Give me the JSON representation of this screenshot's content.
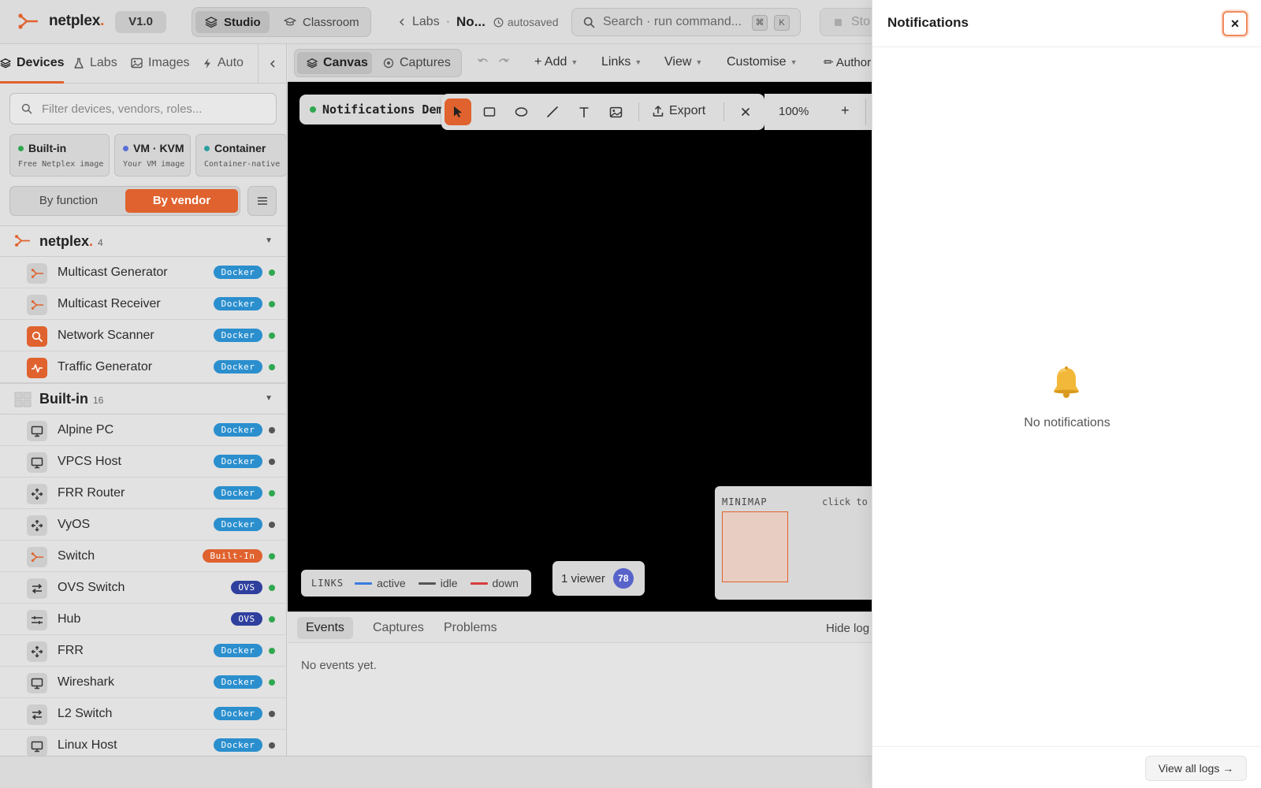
{
  "header": {
    "app_name": "netplex",
    "app_name_suffix": ".",
    "version": "V1.0",
    "modes": [
      "Studio",
      "Classroom"
    ],
    "active_mode": "Studio",
    "breadcrumb": {
      "back_label": "Labs",
      "separator": "·",
      "lab_name": "No..."
    },
    "autosave_status": "autosaved",
    "search": {
      "placeholder": "Search · run command...",
      "shortcut_keys": [
        "⌘",
        "K"
      ]
    },
    "stop_label": "Sto"
  },
  "sidebar": {
    "tabs": [
      "Devices",
      "Labs",
      "Images",
      "Auto"
    ],
    "active_tab": "Devices",
    "filter_placeholder": "Filter devices, vendors, roles...",
    "type_cards": [
      {
        "title": "Built-in",
        "subtitle": "Free Netplex image",
        "color": "#2fa84f"
      },
      {
        "title": "VM · KVM",
        "subtitle": "Your VM image",
        "color": "#5b6fd8"
      },
      {
        "title": "Container",
        "subtitle": "Container-native",
        "color": "#2ba0a0"
      }
    ],
    "grouping": {
      "options": [
        "By function",
        "By vendor"
      ],
      "active": "By vendor"
    },
    "sections": [
      {
        "title": "netplex",
        "title_suffix": ".",
        "count": "4",
        "devices": [
          {
            "name": "Multicast Generator",
            "badge": "Docker",
            "status": "up"
          },
          {
            "name": "Multicast Receiver",
            "badge": "Docker",
            "status": "up"
          },
          {
            "name": "Network Scanner",
            "badge": "Docker",
            "status": "up"
          },
          {
            "name": "Traffic Generator",
            "badge": "Docker",
            "status": "up"
          }
        ]
      },
      {
        "title": "Built-in",
        "title_suffix": "",
        "count": "16",
        "devices": [
          {
            "name": "Alpine PC",
            "badge": "Docker",
            "status": "idle"
          },
          {
            "name": "VPCS Host",
            "badge": "Docker",
            "status": "idle"
          },
          {
            "name": "FRR Router",
            "badge": "Docker",
            "status": "up"
          },
          {
            "name": "VyOS",
            "badge": "Docker",
            "status": "idle"
          },
          {
            "name": "Switch",
            "badge": "Built-In",
            "status": "up"
          },
          {
            "name": "OVS Switch",
            "badge": "OVS",
            "status": "up"
          },
          {
            "name": "Hub",
            "badge": "OVS",
            "status": "up"
          },
          {
            "name": "FRR",
            "badge": "Docker",
            "status": "up"
          },
          {
            "name": "Wireshark",
            "badge": "Docker",
            "status": "up"
          },
          {
            "name": "L2 Switch",
            "badge": "Docker",
            "status": "idle"
          },
          {
            "name": "Linux Host",
            "badge": "Docker",
            "status": "idle"
          }
        ]
      }
    ]
  },
  "workspace": {
    "views": [
      "Canvas",
      "Captures"
    ],
    "active_view": "Canvas",
    "menus": [
      "+ Add",
      "Links",
      "View",
      "Customise"
    ],
    "author_label": "✏ Author",
    "lab_title": "Notifications Demo",
    "export_label": "Export",
    "zoom": "100%",
    "zoom_in": "+",
    "legend": {
      "title": "LINKS",
      "items": [
        {
          "label": "active",
          "color": "#3a7be0"
        },
        {
          "label": "idle",
          "color": "#555555"
        },
        {
          "label": "down",
          "color": "#d83b3b"
        }
      ]
    },
    "viewers": {
      "label": "1 viewer",
      "avatar": "78"
    },
    "minimap": {
      "title": "MINIMAP",
      "hint": "click to"
    },
    "log_tabs": [
      "Events",
      "Captures",
      "Problems"
    ],
    "active_log_tab": "Events",
    "hide_log": "Hide log",
    "events_empty": "No events yet."
  },
  "notifications": {
    "title": "Notifications",
    "close_label": "×",
    "empty_icon": "bell-icon",
    "empty_message": "No notifications",
    "view_all": "View all logs →"
  },
  "colors": {
    "accent": "#e0622e",
    "status_up": "#2fa84f",
    "status_idle": "#555555",
    "badge_docker": "#2b8fce",
    "badge_builtin": "#e0622e",
    "badge_ovs": "#2f3f9e"
  }
}
